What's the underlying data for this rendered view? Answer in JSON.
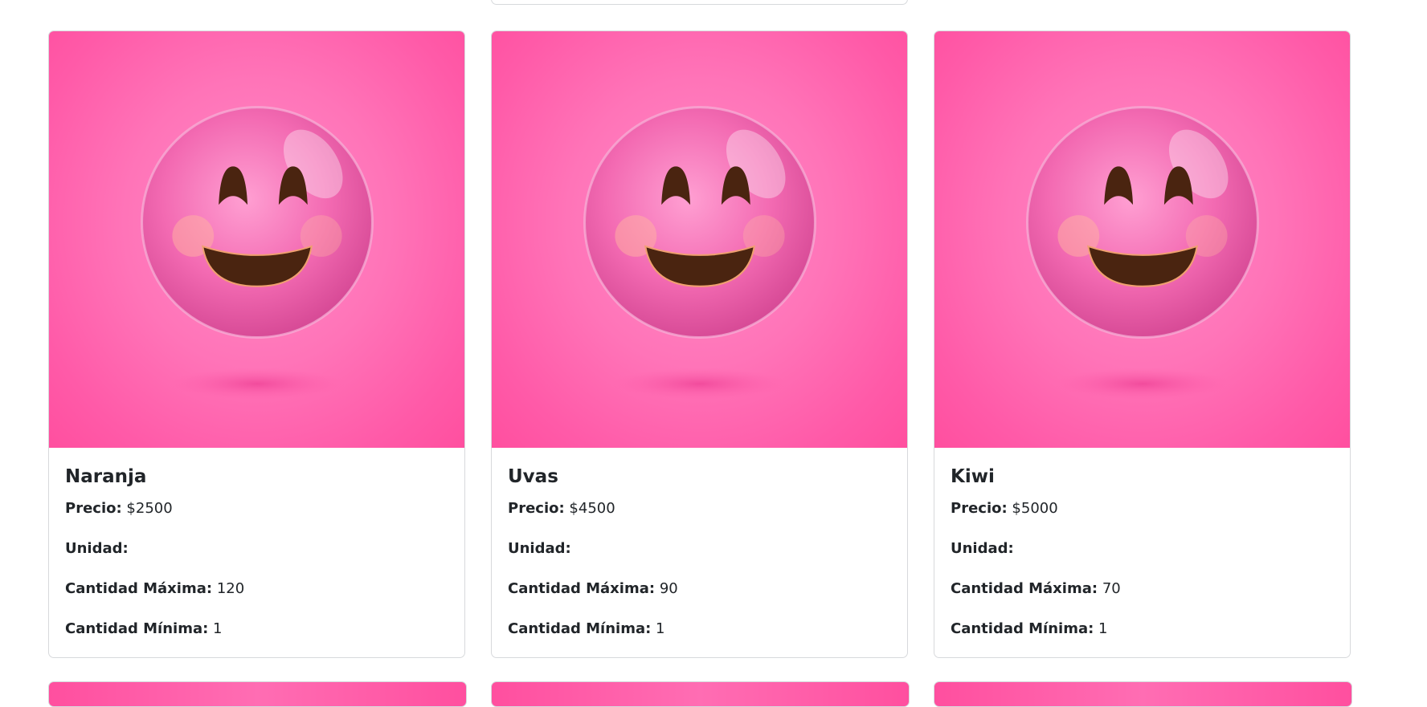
{
  "products": [
    {
      "name": "Naranja",
      "price_label": "Precio:",
      "price": "$2500",
      "unit_label": "Unidad:",
      "unit": "",
      "max_label": "Cantidad Máxima:",
      "max": "120",
      "min_label": "Cantidad Mínima:",
      "min": "1"
    },
    {
      "name": "Uvas",
      "price_label": "Precio:",
      "price": "$4500",
      "unit_label": "Unidad:",
      "unit": "",
      "max_label": "Cantidad Máxima:",
      "max": "90",
      "min_label": "Cantidad Mínima:",
      "min": "1"
    },
    {
      "name": "Kiwi",
      "price_label": "Precio:",
      "price": "$5000",
      "unit_label": "Unidad:",
      "unit": "",
      "max_label": "Cantidad Máxima:",
      "max": "70",
      "min_label": "Cantidad Mínima:",
      "min": "1"
    }
  ],
  "colors": {
    "image_pink": "#ff6db3",
    "card_border": "#d7d9dc",
    "text": "#212529"
  },
  "image_icon": "smiling-emoji-icon"
}
